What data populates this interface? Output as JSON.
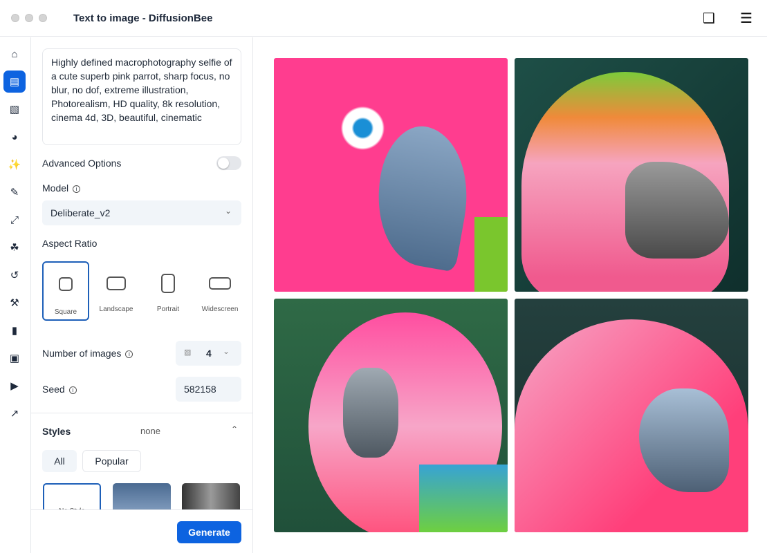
{
  "window": {
    "title": "Text to image - DiffusionBee"
  },
  "toolbar": {
    "icons": [
      "window-stack-icon",
      "hamburger-menu-icon"
    ]
  },
  "sidebar": {
    "items": [
      {
        "icon": "home-icon"
      },
      {
        "icon": "text-to-image-icon",
        "active": true
      },
      {
        "icon": "image-to-image-icon"
      },
      {
        "icon": "palette-icon"
      },
      {
        "icon": "magic-wand-icon"
      },
      {
        "icon": "brush-icon"
      },
      {
        "icon": "expand-icon"
      },
      {
        "icon": "blend-icon"
      },
      {
        "icon": "history-icon"
      },
      {
        "icon": "tools-icon"
      },
      {
        "icon": "document-icon"
      },
      {
        "icon": "gallery-icon"
      },
      {
        "icon": "video-camera-icon"
      },
      {
        "icon": "hammer-icon"
      }
    ]
  },
  "panel": {
    "prompt": "Highly defined macrophotography selfie of a cute superb pink parrot, sharp focus, no blur, no dof, extreme illustration, Photorealism, HD quality, 8k resolution, cinema 4d, 3D, beautiful, cinematic",
    "advanced_options": {
      "label": "Advanced Options",
      "enabled": false
    },
    "model": {
      "label": "Model",
      "value": "Deliberate_v2"
    },
    "aspect_ratio": {
      "label": "Aspect Ratio",
      "options": [
        "Square",
        "Landscape",
        "Portrait",
        "Widescreen"
      ],
      "selected": "Square"
    },
    "num_images": {
      "label": "Number of images",
      "value": "4"
    },
    "seed": {
      "label": "Seed",
      "value": "582158"
    },
    "styles": {
      "label": "Styles",
      "value": "none",
      "tabs": [
        "All",
        "Popular"
      ],
      "active_tab": "All",
      "first_style": "No Style"
    },
    "generate_label": "Generate"
  },
  "colors": {
    "accent": "#0d63e0"
  },
  "results": {
    "count": 4
  }
}
